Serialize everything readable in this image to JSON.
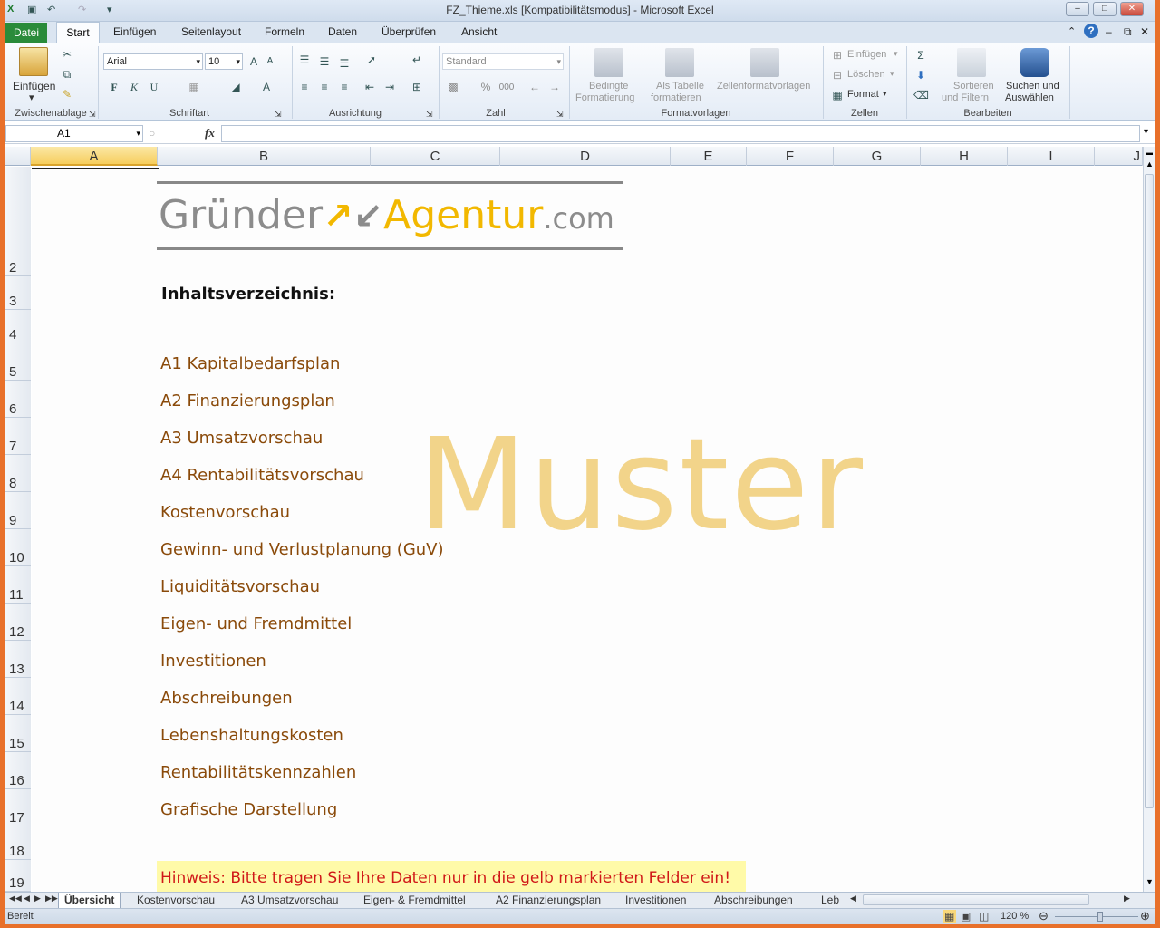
{
  "window": {
    "title": "FZ_Thieme.xls  [Kompatibilitätsmodus]  -  Microsoft Excel"
  },
  "ribbon_tabs": [
    "Datei",
    "Start",
    "Einfügen",
    "Seitenlayout",
    "Formeln",
    "Daten",
    "Überprüfen",
    "Ansicht"
  ],
  "ribbon": {
    "clipboard": {
      "paste_label": "Einfügen",
      "group": "Zwischenablage"
    },
    "font": {
      "name": "Arial",
      "size": "10",
      "bold": "F",
      "italic": "K",
      "underline": "U",
      "group": "Schriftart"
    },
    "alignment": {
      "group": "Ausrichtung"
    },
    "number": {
      "format": "Standard",
      "percent": "%",
      "thousands": "000",
      "group": "Zahl"
    },
    "styles": {
      "conditional": [
        "Bedingte",
        "Formatierung"
      ],
      "as_table": [
        "Als Tabelle",
        "formatieren"
      ],
      "cell_styles": "Zellenformatvorlagen",
      "group": "Formatvorlagen"
    },
    "cells": {
      "insert": "Einfügen",
      "delete": "Löschen",
      "format": "Format",
      "group": "Zellen"
    },
    "editing": {
      "sum": "Σ",
      "sort": [
        "Sortieren",
        "und Filtern"
      ],
      "find": [
        "Suchen und",
        "Auswählen"
      ],
      "group": "Bearbeiten"
    }
  },
  "formula_bar": {
    "name_box": "A1",
    "fx": "fx",
    "value": ""
  },
  "columns": [
    "A",
    "B",
    "C",
    "D",
    "E",
    "F",
    "G",
    "H",
    "I",
    "J"
  ],
  "rows": [
    "2",
    "3",
    "4",
    "5",
    "6",
    "7",
    "8",
    "9",
    "10",
    "11",
    "12",
    "13",
    "14",
    "15",
    "16",
    "17",
    "18",
    "19"
  ],
  "sheet": {
    "logo": {
      "part1": "Gründer",
      "part2": "Agentur",
      "part3": ".com"
    },
    "toc_heading": "Inhaltsverzeichnis:",
    "toc_items": [
      "A1 Kapitalbedarfsplan",
      "A2 Finanzierungsplan",
      "A3 Umsatzvorschau",
      "A4 Rentabilitätsvorschau",
      "Kostenvorschau",
      "Gewinn- und Verlustplanung (GuV)",
      "Liquiditätsvorschau",
      "Eigen- und Fremdmittel",
      "Investitionen",
      "Abschreibungen",
      "Lebenshaltungskosten",
      "Rentabilitätskennzahlen",
      "Grafische Darstellung"
    ],
    "watermark": "Muster",
    "hint": "Hinweis: Bitte tragen Sie Ihre Daten nur in die gelb markierten Felder ein!"
  },
  "sheet_tabs": [
    "Übersicht",
    "Kostenvorschau",
    "A3 Umsatzvorschau",
    "Eigen- & Fremdmittel",
    "A2 Finanzierungsplan",
    "Investitionen",
    "Abschreibungen",
    "Leb"
  ],
  "status": {
    "ready": "Bereit",
    "zoom": "120 %"
  },
  "colors": {
    "accent_green": "#2a8b3a",
    "toc_text": "#8a4a0a",
    "hint_bg": "#fffaa8",
    "hint_text": "#d01818",
    "logo_yellow": "#f2b800"
  }
}
